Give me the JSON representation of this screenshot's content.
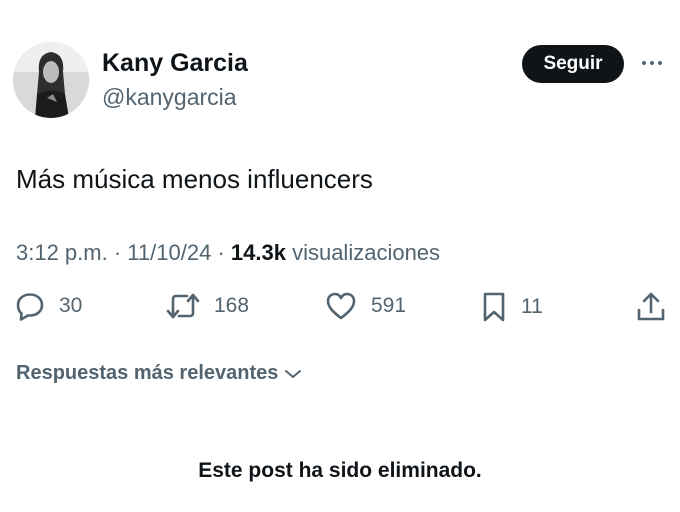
{
  "author": {
    "name": "Kany Garcia",
    "handle": "@kanygarcia",
    "follow_label": "Seguir"
  },
  "tweet": {
    "text": "Más música menos influencers",
    "time": "3:12 p.m.",
    "date": "11/10/24",
    "views_count": "14.3k",
    "views_label": "visualizaciones"
  },
  "actions": {
    "replies": "30",
    "reposts": "168",
    "likes": "591",
    "bookmarks": "11"
  },
  "replies_sort_label": "Respuestas más relevantes",
  "deleted_notice": "Este post ha sido eliminado.",
  "icons": [
    "more-icon",
    "reply-icon",
    "repost-icon",
    "like-icon",
    "bookmark-icon",
    "share-icon",
    "chevron-down-icon"
  ],
  "colors": {
    "text": "#0f1419",
    "secondary": "#536471",
    "button_bg": "#0f1419",
    "button_text": "#ffffff"
  }
}
